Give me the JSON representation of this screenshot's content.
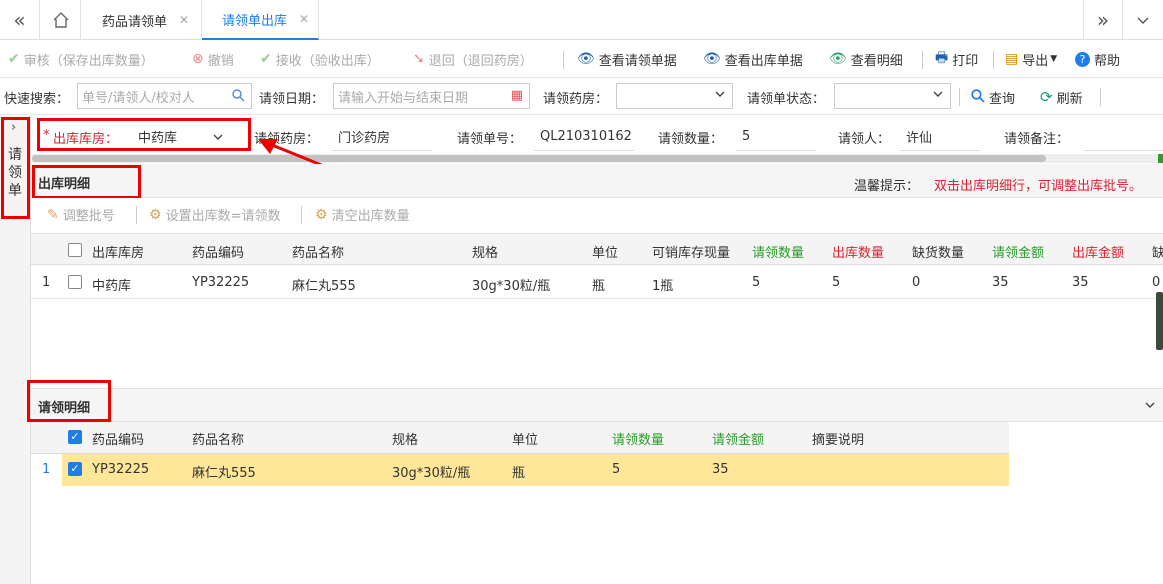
{
  "tabs": {
    "home_label": "",
    "tab1": "药品请领单",
    "tab2": "请领单出库"
  },
  "toolbar": {
    "audit": "审核（保存出库数量）",
    "revoke": "撤销",
    "receive": "接收（验收出库）",
    "return": "退回（退回药房）",
    "view_request": "查看请领单据",
    "view_out": "查看出库单据",
    "view_detail": "查看明细",
    "print": "打印",
    "export": "导出",
    "help": "帮助"
  },
  "search": {
    "quick_label": "快速搜索：",
    "quick_placeholder": "单号/请领人/校对人",
    "date_label": "请领日期：",
    "date_placeholder": "请输入开始与结束日期",
    "pharmacy_label": "请领药房：",
    "status_label": "请领单状态：",
    "query": "查询",
    "refresh": "刷新"
  },
  "leftbar": {
    "label": "请领单"
  },
  "form": {
    "out_store_label": "出库库房：",
    "out_store_value": "中药库",
    "req_pharmacy_label": "请领药房：",
    "req_pharmacy_value": "门诊药房",
    "req_no_label": "请领单号：",
    "req_no_value": "QL210310162",
    "req_qty_label": "请领数量：",
    "req_qty_value": "5",
    "requester_label": "请领人：",
    "requester_value": "许仙",
    "remark_label": "请领备注："
  },
  "out_section": {
    "title": "出库明细",
    "tip_label": "温馨提示：",
    "tip_text": "双击出库明细行，可调整出库批号。",
    "btn_adjust": "调整批号",
    "btn_set": "设置出库数=请领数",
    "btn_clear": "清空出库数量",
    "columns": [
      "出库库房",
      "药品编码",
      "药品名称",
      "规格",
      "单位",
      "可销库存现量",
      "请领数量",
      "出库数量",
      "缺货数量",
      "请领金额",
      "出库金额",
      "缺"
    ],
    "rows": [
      {
        "no": "1",
        "cells": [
          "中药库",
          "YP32225",
          "麻仁丸555",
          "30g*30粒/瓶",
          "瓶",
          "1瓶",
          "5",
          "5",
          "0",
          "35",
          "35",
          "0"
        ]
      }
    ]
  },
  "req_section": {
    "title": "请领明细",
    "columns": [
      "药品编码",
      "药品名称",
      "规格",
      "单位",
      "请领数量",
      "请领金额",
      "摘要说明"
    ],
    "rows": [
      {
        "no": "1",
        "cells": [
          "YP32225",
          "麻仁丸555",
          "30g*30粒/瓶",
          "瓶",
          "5",
          "35",
          ""
        ]
      }
    ]
  },
  "colors": {
    "accent": "#1e7ee8",
    "highlight": "#e00000",
    "row_selected": "#ffe79a"
  }
}
